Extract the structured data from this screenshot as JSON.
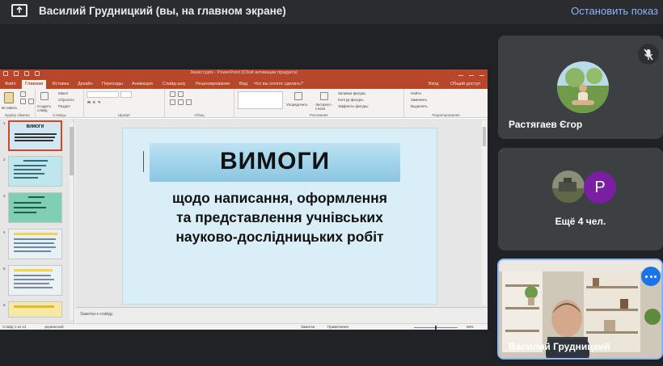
{
  "meet": {
    "presenter_title": "Василий Грудницкий (вы, на главном экране)",
    "stop_label": "Остановить показ",
    "colors": {
      "bg": "#202124",
      "accent": "#8ab4f8",
      "tile": "#3c4043",
      "avatar_purple": "#7b1fa2"
    }
  },
  "ppt": {
    "window_title": "Захист.pptx - PowerPoint (Сбой активации продукта)",
    "tabs": [
      "Файл",
      "Главная",
      "Вставка",
      "Дизайн",
      "Переходы",
      "Анимация",
      "Слайд-шоу",
      "Рецензирование",
      "Вид",
      "Что вы хотите сделать?",
      "Вход",
      "Общий доступ"
    ],
    "active_tab": "Главная",
    "ribbon": {
      "paste": "Вставить",
      "clipboard": "Буфер обмена",
      "new_slide": "Создать слайд",
      "layout": "Макет",
      "reset": "Сбросить",
      "section": "Раздел",
      "slides": "Слайды",
      "font": "Шрифт",
      "paragraph": "Абзац",
      "arrange": "Упорядочить",
      "quick_styles": "Экспресс-стили",
      "fill": "Заливка фигуры",
      "outline": "Контур фигуры",
      "effects": "Эффекты фигуры",
      "drawing": "Рисование",
      "find": "Найти",
      "replace": "Заменить",
      "select": "Выделить",
      "editing": "Редактирование"
    },
    "thumbnails": [
      {
        "num": "1",
        "title": "ВИМОГИ",
        "bg": "#cfe8f3"
      },
      {
        "num": "2",
        "title": "",
        "bg": "#bfe6ec"
      },
      {
        "num": "3",
        "title": "",
        "bg": "#7ecfb3"
      },
      {
        "num": "4",
        "title": "",
        "bg": "#e8f0f5"
      },
      {
        "num": "5",
        "title": "",
        "bg": "#eaf2f6"
      },
      {
        "num": "6",
        "title": "",
        "bg": "#f6e9a8"
      }
    ],
    "slide": {
      "title": "ВИМОГИ",
      "line1": "щодо написання, оформлення",
      "line2": "та представлення учнівських",
      "line3": "науково-дослідницьких робіт"
    },
    "notes_placeholder": "Заметки к слайду",
    "status": {
      "slide_info": "Слайд 1 из 12",
      "language": "украинский",
      "notes": "Заметки",
      "comments": "Примечания",
      "zoom": "65%"
    }
  },
  "participants": {
    "tile1_name": "Растягаев Єгор",
    "more_label": "Ещё 4 чел.",
    "more_avatar_letter": "P",
    "self_name": "Василий Грудницкий"
  }
}
